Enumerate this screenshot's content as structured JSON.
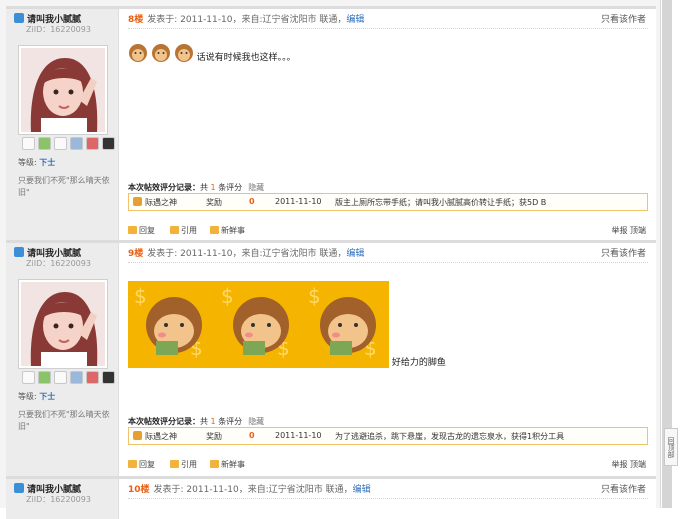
{
  "posts": [
    {
      "username": "请叫我小腻腻",
      "uid": "ZiID：16220093",
      "level_label": "等级:",
      "level": "下士",
      "signature": "只要我们不死\"那么晴天依旧\"",
      "floor": "8楼",
      "meta": "发表于: 2011-11-10，来自:辽宁省沈阳市 联通，",
      "edit": "编辑",
      "only_author": "只看该作者",
      "content_text": "话说有时候我也这样。。。",
      "rate_title": "本次帖效评分记录：",
      "rate_prefix": "共",
      "rate_count": "1",
      "rate_suffix": "条评分",
      "rate_hide": "隐藏",
      "rater": "际遇之神",
      "reward": "奖励",
      "reward_value": "0",
      "rate_date": "2011-11-10",
      "rate_reason": "版主上厕所忘带手纸；请叫我小腻腻高价转让手纸；获5D B",
      "reply": "回复",
      "quote": "引用",
      "fresh": "新鲜事",
      "report": "举报",
      "upvote": "顶端"
    },
    {
      "username": "请叫我小腻腻",
      "uid": "ZiID：16220093",
      "level_label": "等级:",
      "level": "下士",
      "signature": "只要我们不死\"那么晴天依旧\"",
      "floor": "9楼",
      "meta": "发表于: 2011-11-10，来自:辽宁省沈阳市 联通，",
      "edit": "编辑",
      "only_author": "只看该作者",
      "content_text": "好给力的脚鱼",
      "rate_title": "本次帖效评分记录：",
      "rate_prefix": "共",
      "rate_count": "1",
      "rate_suffix": "条评分",
      "rate_hide": "隐藏",
      "rater": "际遇之神",
      "reward": "奖励",
      "reward_value": "0",
      "rate_date": "2011-11-10",
      "rate_reason": "为了逃避追杀，跳下悬崖，发现古龙的遗忘泉水，获得1积分工具",
      "reply": "回复",
      "quote": "引用",
      "fresh": "新鲜事",
      "report": "举报",
      "upvote": "顶端"
    },
    {
      "username": "请叫我小腻腻",
      "uid": "ZiID：16220093",
      "floor": "10楼",
      "meta": "发表于: 2011-11-10，来自:辽宁省沈阳市 联通，",
      "edit": "编辑",
      "only_author": "只看该作者"
    }
  ],
  "back_to_top": "回顶部",
  "colors": {
    "floor": "#e85f14",
    "link": "#2f6eb8",
    "rate_border": "#f0c46a"
  },
  "icons": [
    "user-icon",
    "message-icon",
    "add-friend-icon",
    "profile-icon",
    "gallery-icon",
    "blocks-icon",
    "qq-icon",
    "reply-icon",
    "quote-icon",
    "fresh-icon",
    "rate-icon"
  ]
}
